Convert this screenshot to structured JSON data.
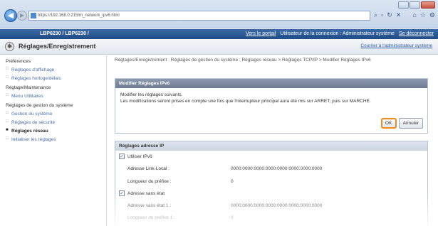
{
  "browser": {
    "url": "https://192.168.0.215/m_network_ipv6.html",
    "search_icon": "search-icon",
    "tools": [
      "search-icon",
      "lock-icon",
      "refresh-icon",
      "close-icon"
    ]
  },
  "header": {
    "device": "LBP6230 / LBP6230 /",
    "portal": "Vers le portail",
    "user": "Utilisateur de la connexion : Administrateur système",
    "logout": "Se déconnecter"
  },
  "title_row": {
    "title": "Réglages/Enregistrement",
    "mail_admin": "Courrier à l'administrateur système"
  },
  "sidebar": {
    "groups": [
      {
        "label": "Préférences",
        "items": [
          "Réglages d'affichage",
          "Réglages horloge/délais"
        ]
      },
      {
        "label": "Réglage/Maintenance",
        "items": [
          "Menu Utilitaires"
        ]
      },
      {
        "label": "Réglages de gestion du système",
        "items": [
          "Gestion du système",
          "Réglages de sécurité",
          "Réglages réseau",
          "Initialiser les réglages"
        ]
      }
    ],
    "active": "Réglages réseau"
  },
  "breadcrumb": "Réglages/Enregistrement : Réglages de gestion du système : Réglages réseau > Réglages TCP/IP > Modifier Réglages IPv6",
  "modify_panel": {
    "title": "Modifier Réglages IPv6",
    "line1": "Modifier les réglages suivants.",
    "line2": "Les modifications seront prises en compte une fois que l'interrupteur principal aura été mis sur ARRET, puis sur MARCHE.",
    "ok": "OK",
    "cancel": "Annuler"
  },
  "ip_panel": {
    "title": "Réglages adresse IP",
    "use_ipv6": "Utiliser IPv6",
    "link_local_label": "Adresse Link-Local :",
    "link_local_value": "0000:0000:0000:0000:0000:0000:0000:0000",
    "prefix_label": "Longueur du préfixe :",
    "prefix_value": "0",
    "stateless_label": "Adresse sans état",
    "stateless1_label": "Adresse sans état 1 :",
    "stateless1_value": "0000:0000:0000:0000:0000:0000:0000:0000",
    "prefix1_label": "Longueur du préfixe 1 :",
    "prefix1_value": "0"
  }
}
